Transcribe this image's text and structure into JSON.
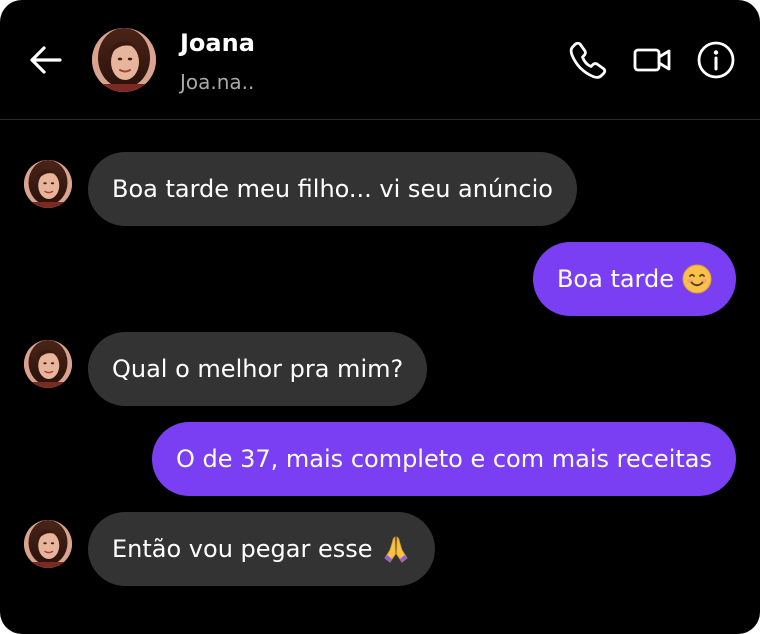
{
  "header": {
    "name": "Joana",
    "username": "Joa.na..",
    "icons": [
      "back-arrow-icon",
      "phone-icon",
      "video-camera-icon",
      "info-icon"
    ]
  },
  "messages": [
    {
      "sender": "contact",
      "text": "Boa tarde meu filho... vi seu anúncio"
    },
    {
      "sender": "me",
      "text": "Boa tarde",
      "emoji": "smiling-face-emoji"
    },
    {
      "sender": "contact",
      "text": "Qual o melhor pra mim?"
    },
    {
      "sender": "me",
      "text": "O de 37, mais completo e com mais receitas"
    },
    {
      "sender": "contact",
      "text": "Então vou pegar esse",
      "emoji": "folded-hands-emoji"
    }
  ],
  "colors": {
    "background": "#000000",
    "incoming_bubble": "#333333",
    "outgoing_bubble": "#7a3ff2",
    "username_text": "#a8a8a8"
  }
}
